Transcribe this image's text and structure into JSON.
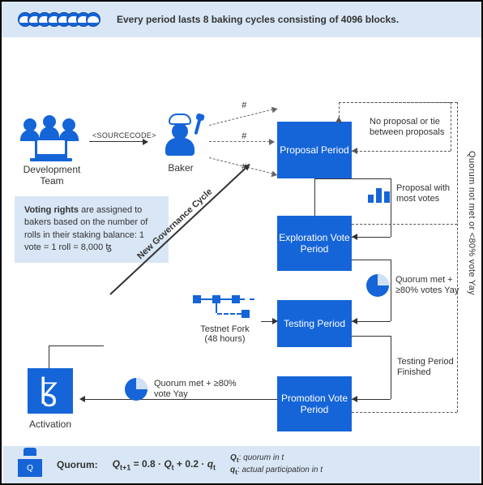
{
  "banner": {
    "text": "Every period lasts 8 baking cycles consisting of 4096 blocks."
  },
  "nodes": {
    "dev_team": "Development Team",
    "baker": "Baker",
    "sourcecode": "<SOURCECODE>",
    "hash": "#",
    "proposal_period": "Proposal Period",
    "exploration_period": "Exploration Vote Period",
    "testing_period": "Testing Period",
    "promotion_period": "Promotion Vote Period",
    "activation": "Activation",
    "new_gov_cycle": "New Governance Cycle",
    "testnet_fork": "Testnet Fork",
    "testnet_hours": "(48 hours)"
  },
  "notes": {
    "no_proposal": "No proposal or tie between proposals",
    "proposal_most_votes": "Proposal with most votes",
    "quorum_met_80": "Quorum met + ≥80% votes Yay",
    "testing_finished": "Testing Period Finished",
    "quorum_met_80b": "Quorum met + ≥80% vote Yay",
    "quorum_not_met": "Quorum not met or <80% vote Yay"
  },
  "voting_rights": {
    "bold": "Voting rights",
    "rest": " are assigned to bakers based on the number of rolls in their staking balance: 1 vote = 1 roll = 8,000 ꜩ"
  },
  "quorum": {
    "label": "Quorum:",
    "icon_letter": "Q",
    "formula": "Q_{t+1} = 0.8 · Q_t + 0.2 · q_t",
    "legend_Q": "Q_t: quorum in t",
    "legend_q": "q_t: actual participation in t"
  },
  "colors": {
    "primary": "#1565d8",
    "panel": "#d8e6f5"
  }
}
